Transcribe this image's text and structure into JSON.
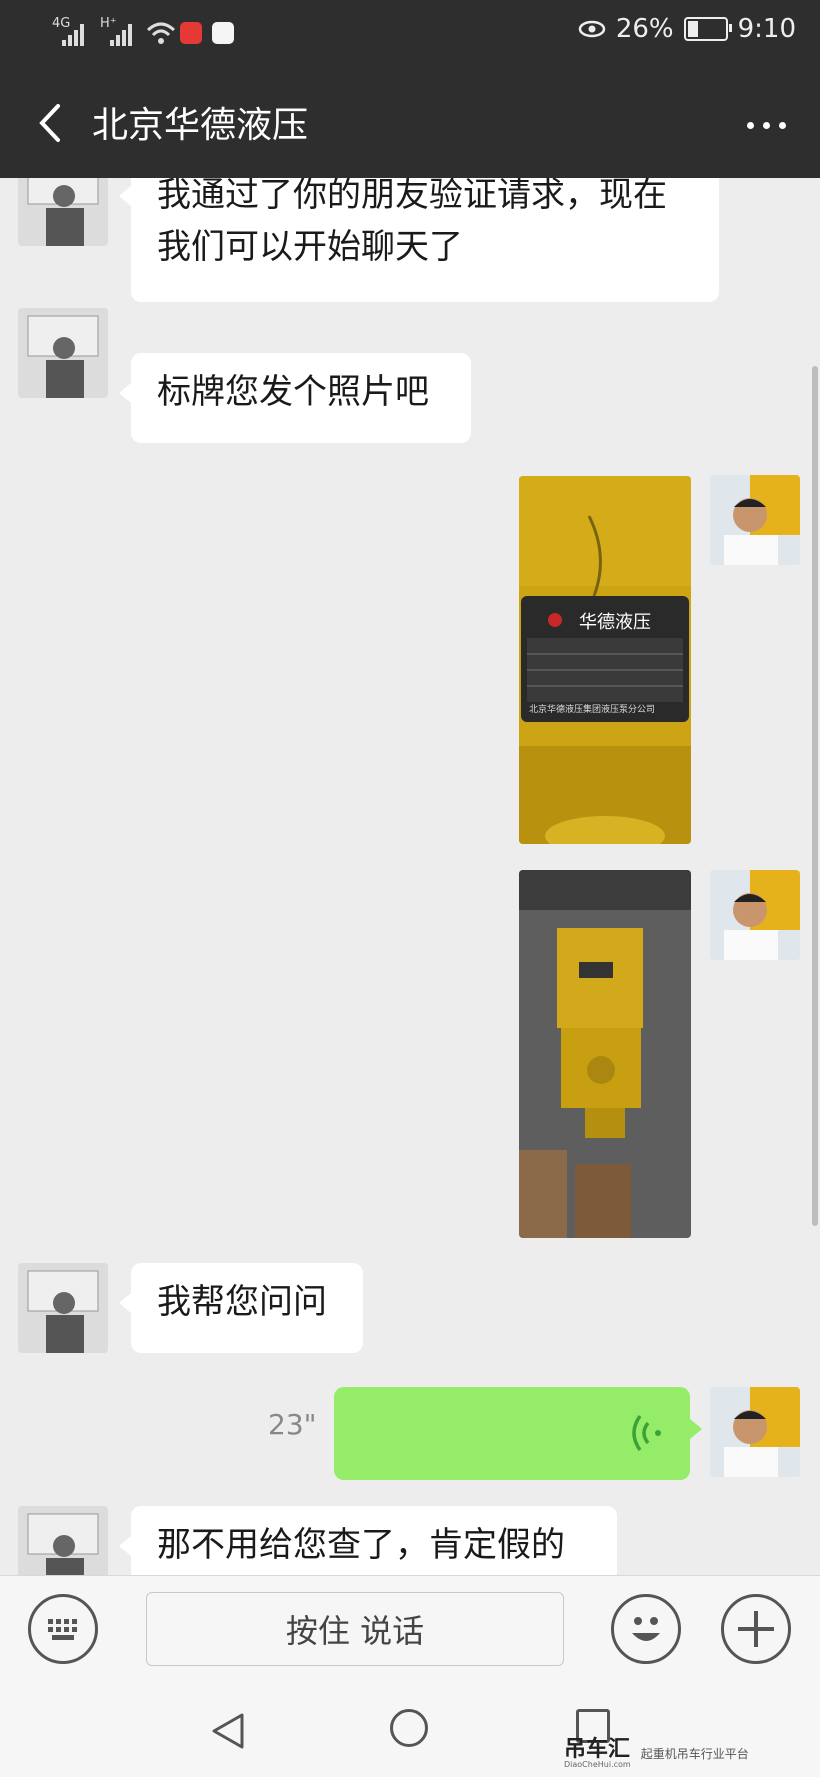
{
  "status_bar": {
    "network1": "4G",
    "network2": "H⁺",
    "battery": "26%",
    "time": "9:10"
  },
  "header": {
    "title": "北京华德液压"
  },
  "messages": [
    {
      "side": "left",
      "type": "text",
      "text": "我通过了你的朋友验证请求，现在我们可以开始聊天了"
    },
    {
      "side": "left",
      "type": "text",
      "text": "标牌您发个照片吧"
    },
    {
      "side": "right",
      "type": "image",
      "label_top": "华德液压",
      "label_bottom": "北京华德液压集团液压泵分公司"
    },
    {
      "side": "right",
      "type": "image"
    },
    {
      "side": "left",
      "type": "text",
      "text": "我帮您问问"
    },
    {
      "side": "right",
      "type": "voice",
      "duration": "23\""
    },
    {
      "side": "left",
      "type": "text",
      "text": "那不用给您查了，肯定假的"
    }
  ],
  "input_bar": {
    "hold_to_talk": "按住 说话"
  },
  "watermark": {
    "logo": "吊车汇",
    "site": "DiaoCheHui.com",
    "tagline": "起重机吊车行业平台"
  },
  "colors": {
    "header_bg": "#2e2e2e",
    "chat_bg": "#ededed",
    "voice_bubble": "#95ec69",
    "voice_icon": "#3da13a"
  }
}
